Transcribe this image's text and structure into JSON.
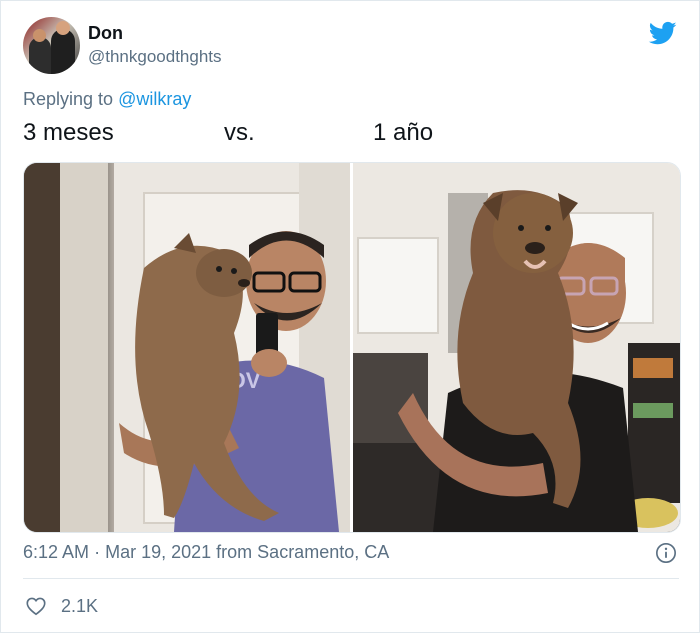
{
  "user": {
    "name": "Don",
    "handle": "@thnkgoodthghts"
  },
  "reply": {
    "prefix": "Replying to",
    "mention": "@wilkray"
  },
  "tweet": {
    "text_left": "3 meses",
    "text_mid": "vs.",
    "text_right": "1 año"
  },
  "media": {
    "left_photo": "dog-puppy-3-months-photo",
    "right_photo": "dog-1-year-photo"
  },
  "meta": {
    "time": "6:12 AM",
    "separator": "·",
    "date": "Mar 19, 2021",
    "source": "from Sacramento, CA"
  },
  "stats": {
    "likes": "2.1K"
  },
  "colors": {
    "accent": "#1da1f2",
    "secondary_text": "#5b7083",
    "link": "#1b95e0"
  },
  "icons": {
    "logo": "twitter-bird-icon",
    "info": "info-icon",
    "like": "heart-icon"
  }
}
